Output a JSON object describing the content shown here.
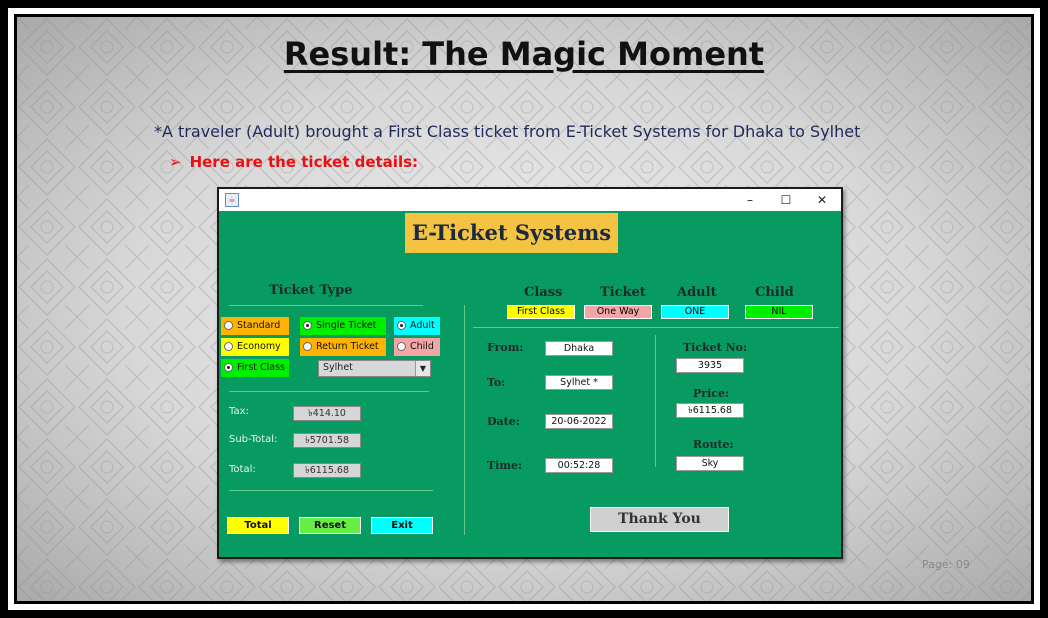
{
  "slide": {
    "title": "Result: The Magic Moment",
    "subtitle": "*A traveler (Adult) brought a First Class ticket from E-Ticket  Systems for Dhaka to Sylhet",
    "bullet_arrow": "➢",
    "bullet": "Here are the ticket details:",
    "page": "Page: 09"
  },
  "window": {
    "minimize": "–",
    "maximize": "☐",
    "close": "✕",
    "app_icon": "java-icon"
  },
  "app": {
    "header": "E-Ticket Systems",
    "ticket_type_label": "Ticket Type",
    "radios": {
      "standard": "Standard",
      "economy": "Economy",
      "first_class": "First Class",
      "single_ticket": "Single Ticket",
      "return_ticket": "Return Ticket",
      "adult": "Adult",
      "child": "Child"
    },
    "destination_select": "Sylhet",
    "tax_label": "Tax:",
    "tax_value": "৳414.10",
    "subtotal_label": "Sub-Total:",
    "subtotal_value": "৳5701.58",
    "total_label": "Total:",
    "total_value": "৳6115.68",
    "buttons": {
      "total": "Total",
      "reset": "Reset",
      "exit": "Exit",
      "thank_you": "Thank You"
    },
    "summary_headers": {
      "class": "Class",
      "ticket": "Ticket",
      "adult": "Adult",
      "child": "Child"
    },
    "summary_values": {
      "class": "First Class",
      "ticket": "One Way",
      "adult": "ONE",
      "child": "NIL"
    },
    "from_label": "From:",
    "from_value": "Dhaka",
    "to_label": "To:",
    "to_value": "Sylhet *",
    "date_label": "Date:",
    "date_value": "20-06-2022",
    "time_label": "Time:",
    "time_value": "00:52:28",
    "ticket_no_label": "Ticket No:",
    "ticket_no_value": "3935",
    "price_label": "Price:",
    "price_value": "৳6115.68",
    "route_label": "Route:",
    "route_value": "Sky"
  },
  "colors": {
    "app_bg": "#079a61",
    "header_bg": "#f5c342",
    "yellow": "#ffff00",
    "orange": "#ffb300",
    "green": "#00ee00",
    "cyan": "#00ffff",
    "pink": "#f4a6a6",
    "title_red": "#e81010"
  }
}
